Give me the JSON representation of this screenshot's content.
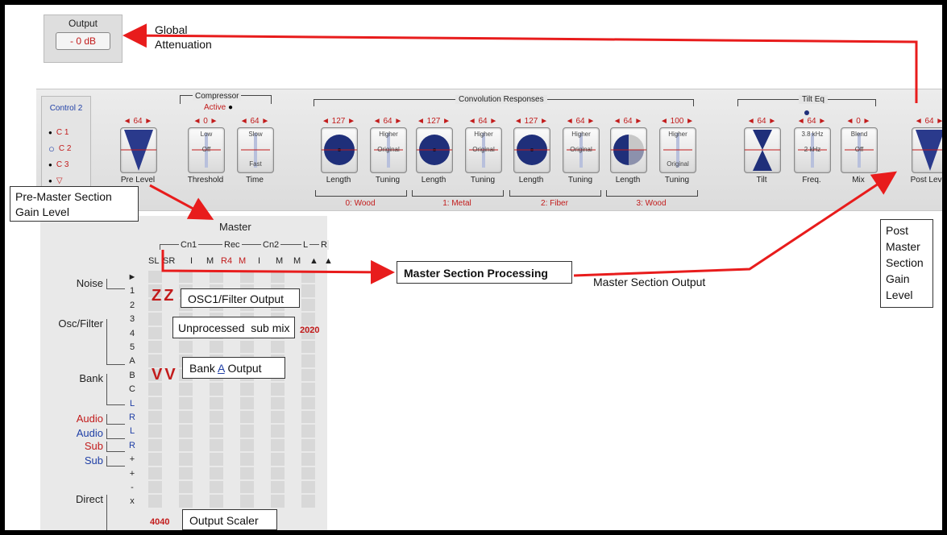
{
  "output_panel": {
    "label": "Output",
    "value": "- 0 dB"
  },
  "annotations": {
    "global_attenuation_line1": "Global",
    "global_attenuation_line2": "Attenuation",
    "pre_master_line1": "Pre-Master Section",
    "pre_master_line2": "Gain Level",
    "post_master_lines": [
      "Post",
      "Master",
      "Section",
      "Gain",
      "Level"
    ],
    "master_processing": "Master Section Processing",
    "master_output": "Master Section Output",
    "osc1_filter_output": "OSC1/Filter Output",
    "unprocessed_sub_mix": "Unprocessed  sub mix",
    "bank_a_output_pre": "Bank ",
    "bank_a_output_u": "A",
    "bank_a_output_post": " Output",
    "output_scaler": "Output Scaler"
  },
  "control_selector": {
    "title": "Control 2",
    "items": [
      {
        "label": "C 1",
        "selected": false
      },
      {
        "label": "C 2",
        "selected": true
      },
      {
        "label": "C 3",
        "selected": false
      },
      {
        "label": "▽",
        "selected": false
      }
    ]
  },
  "sections": {
    "compressor": "Compressor",
    "compressor_active": "Active",
    "convolution": "Convolution Responses",
    "tilt_eq": "Tilt Eq"
  },
  "controls": [
    {
      "label": "Pre Level",
      "value": "64",
      "top": "",
      "mid": "",
      "bottom": "",
      "kind": "triangle"
    },
    {
      "label": "Threshold",
      "value": "0",
      "top": "Low",
      "mid": "Off",
      "bottom": "",
      "kind": "slider"
    },
    {
      "label": "Time",
      "value": "64",
      "top": "Slow",
      "mid": "",
      "bottom": "Fast",
      "kind": "slider"
    },
    {
      "label": "Length",
      "value": "127",
      "top": "",
      "mid": "",
      "bottom": "",
      "kind": "disc"
    },
    {
      "label": "Tuning",
      "value": "64",
      "top": "Higher",
      "mid": "Original",
      "bottom": "",
      "kind": "slider"
    },
    {
      "label": "Length",
      "value": "127",
      "top": "",
      "mid": "",
      "bottom": "",
      "kind": "disc"
    },
    {
      "label": "Tuning",
      "value": "64",
      "top": "Higher",
      "mid": "Original",
      "bottom": "",
      "kind": "slider"
    },
    {
      "label": "Length",
      "value": "127",
      "top": "",
      "mid": "",
      "bottom": "",
      "kind": "disc"
    },
    {
      "label": "Tuning",
      "value": "64",
      "top": "Higher",
      "mid": "Original",
      "bottom": "",
      "kind": "slider"
    },
    {
      "label": "Length",
      "value": "64",
      "top": "",
      "mid": "",
      "bottom": "",
      "kind": "halfdisc"
    },
    {
      "label": "Tuning",
      "value": "100",
      "top": "Higher",
      "mid": "",
      "bottom": "Original",
      "kind": "slider"
    },
    {
      "label": "Tilt",
      "value": "64",
      "top": "",
      "mid": "",
      "bottom": "",
      "kind": "bowtie"
    },
    {
      "label": "Freq.",
      "value": "64",
      "top": "3.8 kHz",
      "mid": "2 kHz",
      "bottom": "",
      "kind": "slider"
    },
    {
      "label": "Mix",
      "value": "0",
      "top": "Blend",
      "mid": "Off",
      "bottom": "",
      "kind": "slider"
    },
    {
      "label": "Post Level",
      "value": "64",
      "top": "",
      "mid": "",
      "bottom": "",
      "kind": "triangle"
    }
  ],
  "convolution_groups": [
    "0: Wood",
    "1: Metal",
    "2: Fiber",
    "3: Wood"
  ],
  "matrix": {
    "title": "Master",
    "group_headers": [
      "Cn1",
      "Rec",
      "Cn2",
      "L",
      "R"
    ],
    "columns": [
      "SL",
      "SR",
      "I",
      "M",
      "R4",
      "M",
      "I",
      "M",
      "M",
      "▲",
      "▲"
    ],
    "row_groups": [
      {
        "label": "Noise",
        "color": "#222222"
      },
      {
        "label": "Osc/Filter",
        "color": "#222222"
      },
      {
        "label": "Bank",
        "color": "#222222"
      },
      {
        "label": "Audio",
        "color": "#c21b1b"
      },
      {
        "label": "Audio",
        "color": "#1f3fa6"
      },
      {
        "label": "Sub",
        "color": "#c21b1b"
      },
      {
        "label": "Sub",
        "color": "#1f3fa6"
      },
      {
        "label": "Direct",
        "color": "#222222"
      }
    ],
    "rows": [
      "►",
      "1",
      "2",
      "3",
      "4",
      "5",
      "A",
      "B",
      "C",
      "L",
      "R",
      "L",
      "R",
      "+",
      "+",
      "-",
      "x"
    ],
    "marks": {
      "zz": "ZZ",
      "vv": "VV",
      "n2020": "2020",
      "n4040": "4040"
    }
  },
  "colors": {
    "accent": "#c21b1b",
    "arrow": "#e81c1c",
    "knob": "#1f2f7a",
    "panel": "#e3e3e3"
  }
}
